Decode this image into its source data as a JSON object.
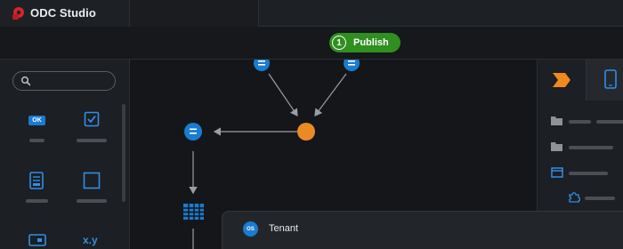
{
  "app": {
    "title": "ODC Studio"
  },
  "toolbar": {
    "publish_count": "1",
    "publish_label": "Publish"
  },
  "toolbox": {
    "search_value": "",
    "widgets": [
      {
        "icon": "ok-button-widget-icon",
        "text": "OK"
      },
      {
        "icon": "checkbox-widget-icon"
      },
      {
        "icon": "form-widget-icon"
      },
      {
        "icon": "container-widget-icon"
      },
      {
        "icon": "input-widget-icon"
      },
      {
        "icon": "expression-widget-icon",
        "text": "x.y"
      }
    ]
  },
  "popup": {
    "badge": "OS",
    "title": "Tenant"
  },
  "colors": {
    "accent_blue": "#1a7cd1",
    "publish_green": "#2f8f1f",
    "orange_node": "#e98a25"
  }
}
